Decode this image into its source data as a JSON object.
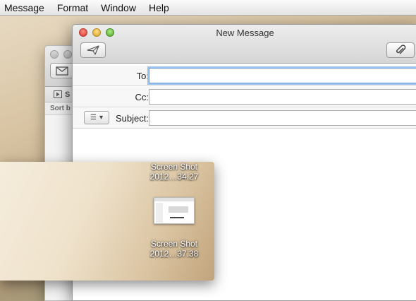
{
  "menubar": {
    "items": [
      "Message",
      "Format",
      "Window",
      "Help"
    ]
  },
  "background_window": {
    "compose_icon": "envelope-icon",
    "tab_label": "S",
    "sort_label": "Sort b"
  },
  "compose_window": {
    "title": "New Message",
    "send_icon": "paper-plane-icon",
    "attach_icon": "paperclip-icon",
    "to_label": "To:",
    "to_value": "",
    "cc_label": "Cc:",
    "cc_value": "",
    "subject_label": "Subject:",
    "subject_value": "",
    "format_icon": "list-format-icon",
    "format_symbol": "☰",
    "dropdown_symbol": "▾"
  },
  "stack": {
    "files": [
      {
        "name_line1": "Screen Shot",
        "name_line2": "2012…34.27"
      },
      {
        "name_line1": "Screen Shot",
        "name_line2": "2012…37.38"
      }
    ]
  }
}
